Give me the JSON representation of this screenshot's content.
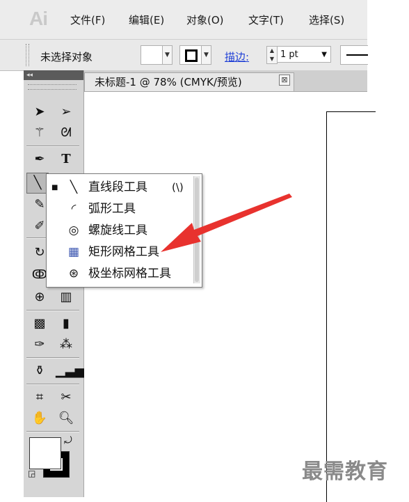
{
  "app": {
    "logo": "Ai"
  },
  "menu": [
    "文件(F)",
    "编辑(E)",
    "对象(O)",
    "文字(T)",
    "选择(S)"
  ],
  "control_bar": {
    "selection_status": "未选择对象",
    "stroke_label": "描边:",
    "stroke_weight": "1 pt"
  },
  "tools_panel": {
    "collapse_glyph": "◂◂"
  },
  "document": {
    "tab_title": "未标题-1 @ 78% (CMYK/预览)",
    "close_glyph": "⊠"
  },
  "flyout": {
    "items": [
      {
        "label": "直线段工具",
        "shortcut": "(\\)",
        "icon": "line-segment-icon",
        "glyph": "╲",
        "current": true
      },
      {
        "label": "弧形工具",
        "shortcut": "",
        "icon": "arc-icon",
        "glyph": "◜",
        "current": false
      },
      {
        "label": "螺旋线工具",
        "shortcut": "",
        "icon": "spiral-icon",
        "glyph": "◎",
        "current": false
      },
      {
        "label": "矩形网格工具",
        "shortcut": "",
        "icon": "rectangular-grid-icon",
        "glyph": "▦",
        "current": false
      },
      {
        "label": "极坐标网格工具",
        "shortcut": "",
        "icon": "polar-grid-icon",
        "glyph": "⊛",
        "current": false
      }
    ]
  },
  "annotation": {
    "arrow_color": "#e8322e"
  },
  "watermark": "最需教育"
}
